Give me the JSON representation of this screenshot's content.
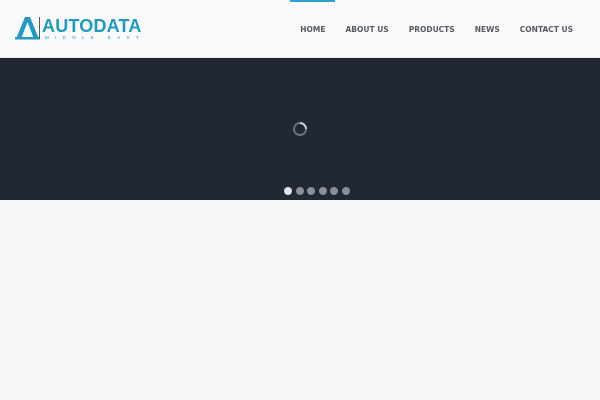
{
  "brand": {
    "name": "AUTODATA",
    "tagline": "MIDDLE EAST",
    "accent_color": "#1e9bc4"
  },
  "nav": {
    "items": [
      {
        "label": "HOME",
        "active": true
      },
      {
        "label": "ABOUT US",
        "active": false
      },
      {
        "label": "PRODUCTS",
        "active": false
      },
      {
        "label": "NEWS",
        "active": false
      },
      {
        "label": "CONTACT US",
        "active": false
      }
    ],
    "active_indicator_color": "#2aa3cf"
  },
  "slider": {
    "background_color": "#222833",
    "loading": true,
    "slide_count": 6,
    "active_slide": 1
  }
}
